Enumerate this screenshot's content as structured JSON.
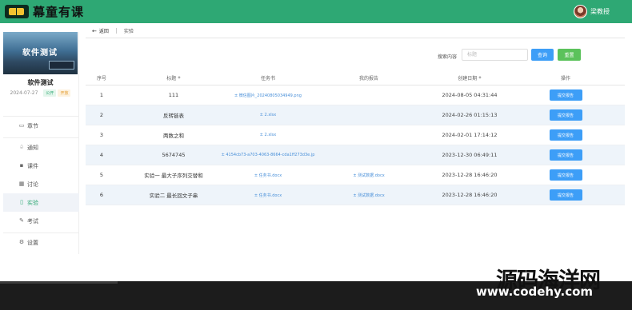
{
  "header": {
    "logo_text": "幕童有课",
    "user_name": "梁教授"
  },
  "sidebar": {
    "cover_title": "软件测试",
    "course_name": "软件测试",
    "course_date": "2024-07-27",
    "tags": [
      "公开",
      "开放"
    ],
    "nav": [
      {
        "label": "章节",
        "icon": "chapter-icon"
      },
      {
        "label": "通知",
        "icon": "bell-icon"
      },
      {
        "label": "课件",
        "icon": "grid-icon"
      },
      {
        "label": "讨论",
        "icon": "discussion-icon"
      },
      {
        "label": "实验",
        "icon": "file-icon"
      },
      {
        "label": "考试",
        "icon": "edit-icon"
      },
      {
        "label": "设置",
        "icon": "gear-icon"
      }
    ]
  },
  "breadcrumb": {
    "back_label": "返回",
    "current": "实验"
  },
  "search": {
    "label": "搜索内容",
    "placeholder": "标题",
    "query_label": "查询",
    "reset_label": "重置"
  },
  "table": {
    "columns": [
      "序号",
      "标题",
      "任务书",
      "我的报告",
      "创建日期",
      "操作"
    ],
    "rows": [
      {
        "no": "1",
        "title": "111",
        "task": "± 微信图片_20240805034949.png",
        "report": "",
        "date": "2024-08-05 04:31:44",
        "action": "提交报告"
      },
      {
        "no": "2",
        "title": "反转链表",
        "task": "± 2.xlsx",
        "report": "",
        "date": "2024-02-26 01:15:13",
        "action": "提交报告"
      },
      {
        "no": "3",
        "title": "两数之和",
        "task": "± 2.xlsx",
        "report": "",
        "date": "2024-02-01 17:14:12",
        "action": "提交报告"
      },
      {
        "no": "4",
        "title": "5674745",
        "task": "± 4154cb73-a703-4063-8664-cda1ff273d3e.jp",
        "report": "",
        "date": "2023-12-30 06:49:11",
        "action": "提交报告"
      },
      {
        "no": "5",
        "title": "实验一 最大子序列交替和",
        "task": "± 任务书.docx",
        "report": "± 测试数据.docx",
        "date": "2023-12-28 16:46:20",
        "action": "提交报告"
      },
      {
        "no": "6",
        "title": "实验二 最长回文子串",
        "task": "± 任务书.docx",
        "report": "± 测试数据.docx",
        "date": "2023-12-28 16:46:20",
        "action": "提交报告"
      }
    ]
  },
  "watermark": {
    "cn": "源码海洋网",
    "url": "www.codehy.com"
  },
  "colors": {
    "brand": "#2ea874",
    "primary_button": "#3d9ef7",
    "reset_button": "#5bc25b"
  }
}
